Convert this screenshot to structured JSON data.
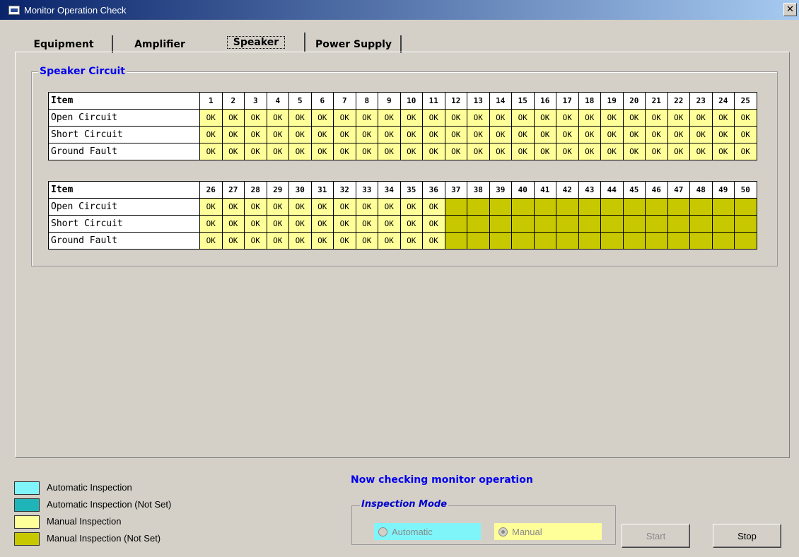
{
  "window": {
    "title": "Monitor Operation Check",
    "close_label": "✕"
  },
  "tabs": [
    {
      "label": "Equipment"
    },
    {
      "label": "Amplifier"
    },
    {
      "label": "Speaker"
    },
    {
      "label": "Power Supply"
    }
  ],
  "group": {
    "title": "Speaker Circuit"
  },
  "table1": {
    "header": "Item",
    "columns": [
      "1",
      "2",
      "3",
      "4",
      "5",
      "6",
      "7",
      "8",
      "9",
      "10",
      "11",
      "12",
      "13",
      "14",
      "15",
      "16",
      "17",
      "18",
      "19",
      "20",
      "21",
      "22",
      "23",
      "24",
      "25"
    ],
    "rows": [
      {
        "label": "Open Circuit",
        "cells": [
          "OK",
          "OK",
          "OK",
          "OK",
          "OK",
          "OK",
          "OK",
          "OK",
          "OK",
          "OK",
          "OK",
          "OK",
          "OK",
          "OK",
          "OK",
          "OK",
          "OK",
          "OK",
          "OK",
          "OK",
          "OK",
          "OK",
          "OK",
          "OK",
          "OK"
        ]
      },
      {
        "label": "Short Circuit",
        "cells": [
          "OK",
          "OK",
          "OK",
          "OK",
          "OK",
          "OK",
          "OK",
          "OK",
          "OK",
          "OK",
          "OK",
          "OK",
          "OK",
          "OK",
          "OK",
          "OK",
          "OK",
          "OK",
          "OK",
          "OK",
          "OK",
          "OK",
          "OK",
          "OK",
          "OK"
        ]
      },
      {
        "label": "Ground Fault",
        "cells": [
          "OK",
          "OK",
          "OK",
          "OK",
          "OK",
          "OK",
          "OK",
          "OK",
          "OK",
          "OK",
          "OK",
          "OK",
          "OK",
          "OK",
          "OK",
          "OK",
          "OK",
          "OK",
          "OK",
          "OK",
          "OK",
          "OK",
          "OK",
          "OK",
          "OK"
        ]
      }
    ]
  },
  "table2": {
    "header": "Item",
    "columns": [
      "26",
      "27",
      "28",
      "29",
      "30",
      "31",
      "32",
      "33",
      "34",
      "35",
      "36",
      "37",
      "38",
      "39",
      "40",
      "41",
      "42",
      "43",
      "44",
      "45",
      "46",
      "47",
      "48",
      "49",
      "50"
    ],
    "rows": [
      {
        "label": "Open Circuit",
        "cells": [
          "OK",
          "OK",
          "OK",
          "OK",
          "OK",
          "OK",
          "OK",
          "OK",
          "OK",
          "OK",
          "OK",
          "",
          "",
          "",
          "",
          "",
          "",
          "",
          "",
          "",
          "",
          "",
          "",
          "",
          ""
        ]
      },
      {
        "label": "Short Circuit",
        "cells": [
          "OK",
          "OK",
          "OK",
          "OK",
          "OK",
          "OK",
          "OK",
          "OK",
          "OK",
          "OK",
          "OK",
          "",
          "",
          "",
          "",
          "",
          "",
          "",
          "",
          "",
          "",
          "",
          "",
          "",
          ""
        ]
      },
      {
        "label": "Ground Fault",
        "cells": [
          "OK",
          "OK",
          "OK",
          "OK",
          "OK",
          "OK",
          "OK",
          "OK",
          "OK",
          "OK",
          "OK",
          "",
          "",
          "",
          "",
          "",
          "",
          "",
          "",
          "",
          "",
          "",
          "",
          "",
          ""
        ]
      }
    ]
  },
  "legend": [
    {
      "label": "Automatic Inspection",
      "color": "#7ff5fa"
    },
    {
      "label": "Automatic Inspection (Not Set)",
      "color": "#1fb5b8"
    },
    {
      "label": "Manual Inspection",
      "color": "#ffff9a"
    },
    {
      "label": "Manual Inspection (Not Set)",
      "color": "#c8c800"
    }
  ],
  "status_text": "Now checking monitor operation",
  "inspection_mode": {
    "title": "Inspection Mode",
    "automatic_label": "Automatic",
    "manual_label": "Manual",
    "selected": "Manual"
  },
  "buttons": {
    "start": "Start",
    "stop": "Stop"
  },
  "colors": {
    "ok_cell": "#ffff9a",
    "not_set_cell": "#c8c800",
    "automatic_bg": "#7ff5fa",
    "manual_bg": "#ffff9a",
    "title_accent": "#0000ee"
  }
}
